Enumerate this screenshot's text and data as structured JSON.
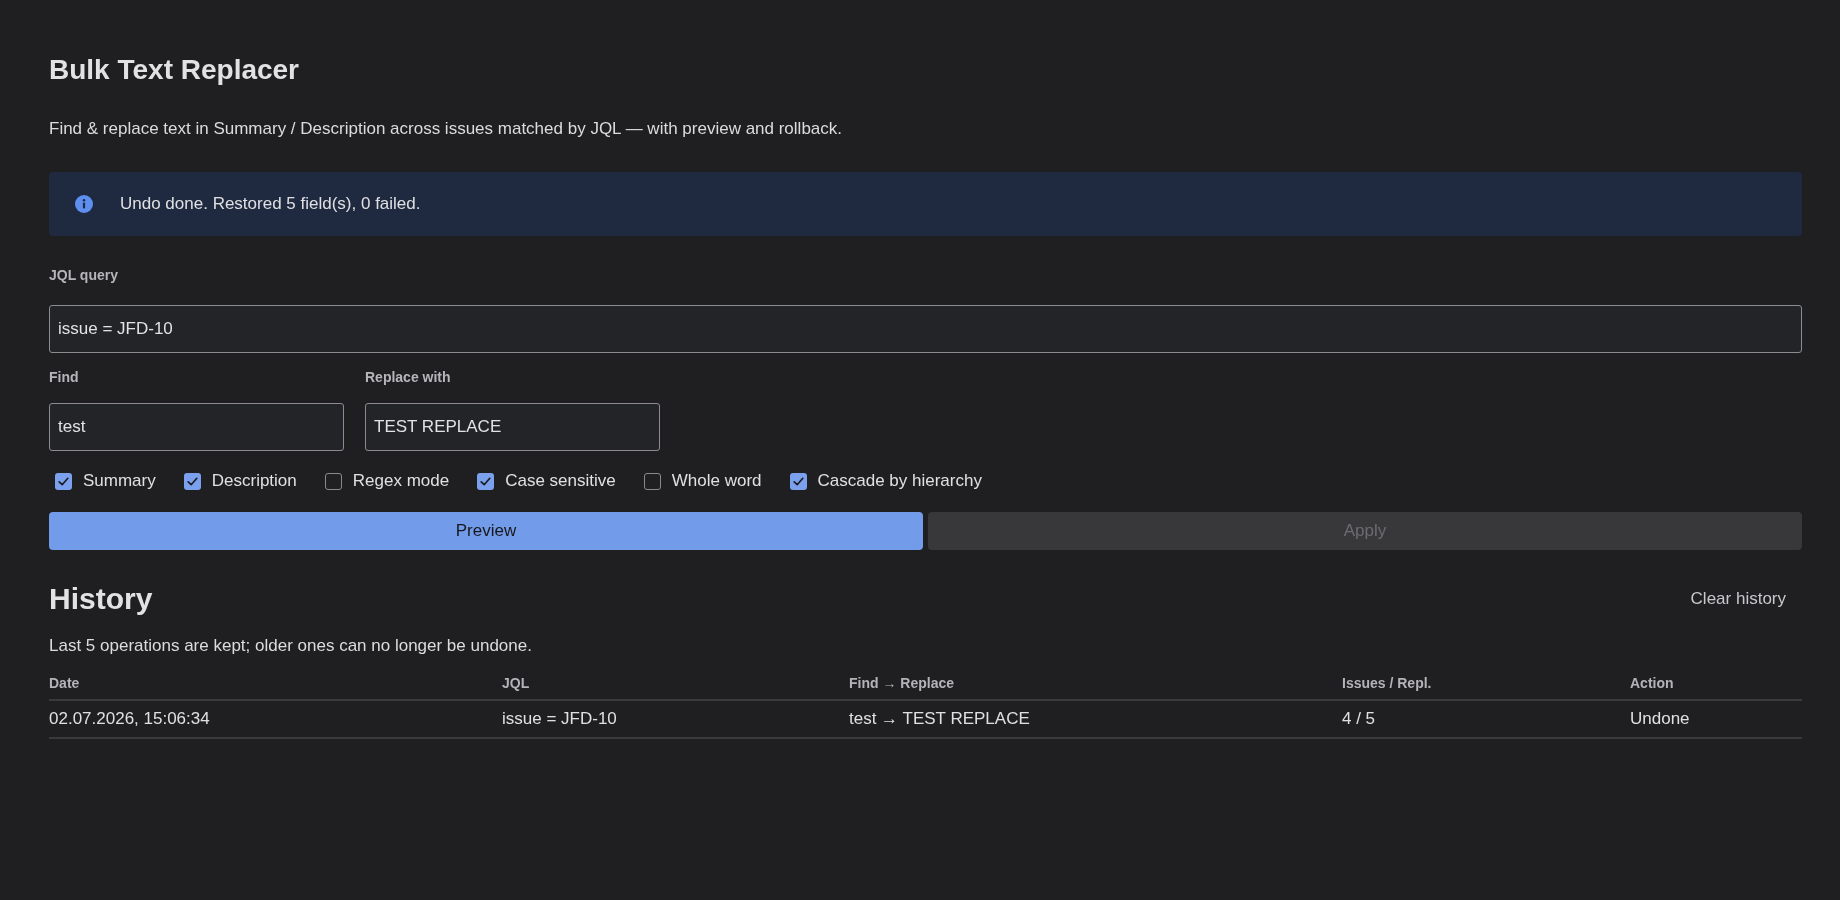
{
  "header": {
    "title": "Bulk Text Replacer",
    "description": "Find & replace text in Summary / Description across issues matched by JQL — with preview and rollback."
  },
  "notice": {
    "kind": "info",
    "message": "Undo done. Restored 5 field(s), 0 failed."
  },
  "form": {
    "jql": {
      "label": "JQL query",
      "value": "issue = JFD-10"
    },
    "find": {
      "label": "Find",
      "value": "test"
    },
    "replace": {
      "label": "Replace with",
      "value": "TEST REPLACE"
    },
    "options": [
      {
        "label": "Summary",
        "checked": true
      },
      {
        "label": "Description",
        "checked": true
      },
      {
        "label": "Regex mode",
        "checked": false
      },
      {
        "label": "Case sensitive",
        "checked": true
      },
      {
        "label": "Whole word",
        "checked": false
      },
      {
        "label": "Cascade by hierarchy",
        "checked": true
      }
    ],
    "preview_button": {
      "label": "Preview",
      "disabled": false
    },
    "apply_button": {
      "label": "Apply",
      "disabled": true
    }
  },
  "history": {
    "title": "History",
    "clear_button": "Clear history",
    "note": "Last 5 operations are kept; older ones can no longer be undone.",
    "columns": [
      "Date",
      "JQL",
      "Find → Replace",
      "Issues / Repl.",
      "Action"
    ],
    "rows": [
      {
        "cells": [
          "02.07.2026, 15:06:34",
          "issue = JFD-10",
          "test → TEST REPLACE",
          "4 / 5",
          "Undone"
        ]
      }
    ]
  }
}
